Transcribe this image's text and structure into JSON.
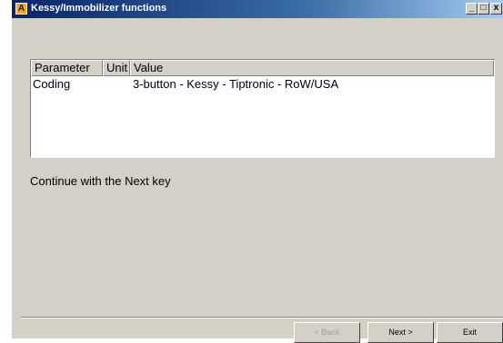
{
  "window": {
    "title": "Kessy/Immobilizer functions",
    "icon_letter": "A",
    "controls": {
      "minimize": "_",
      "maximize": "□",
      "close": "x"
    }
  },
  "table": {
    "columns": [
      "Parameter",
      "Unit",
      "Value"
    ],
    "rows": [
      {
        "parameter": "Coding",
        "unit": "",
        "value": "3-button - Kessy - Tiptronic - RoW/USA"
      }
    ]
  },
  "message": "Continue with the Next key",
  "buttons": {
    "back": {
      "label": "< Back",
      "enabled": false
    },
    "next": {
      "label": "Next >",
      "enabled": true
    },
    "exit": {
      "label": "Exit",
      "enabled": true
    }
  }
}
